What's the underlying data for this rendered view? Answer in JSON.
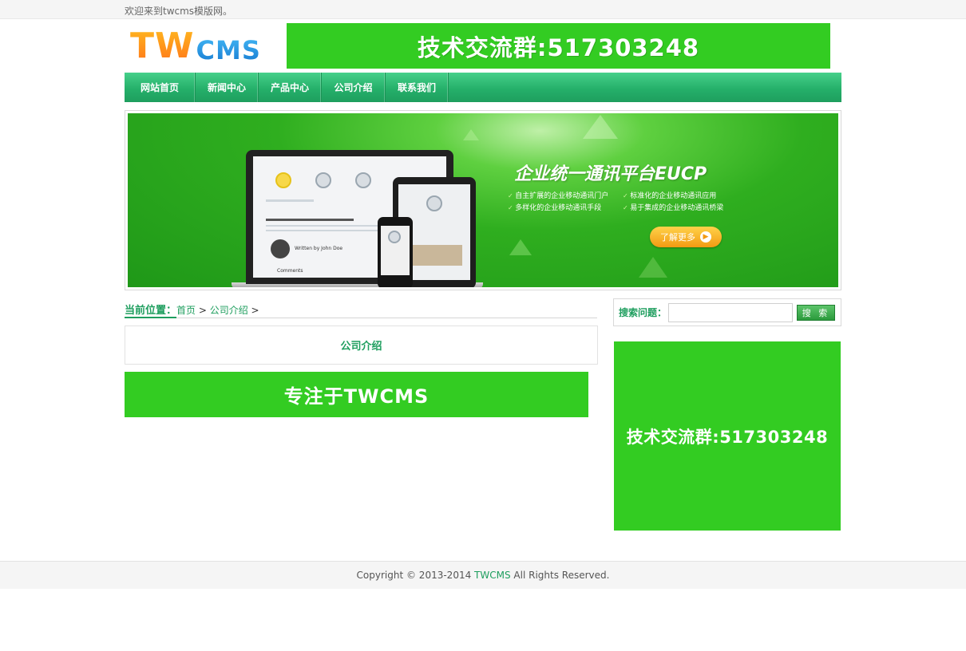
{
  "topbar": {
    "welcome": "欢迎来到twcms模版网。"
  },
  "header": {
    "logo_tw": "TW",
    "logo_cms": "CMS",
    "ad_text": "技术交流群:517303248"
  },
  "nav": {
    "items": [
      {
        "label": "网站首页"
      },
      {
        "label": "新闻中心"
      },
      {
        "label": "产品中心"
      },
      {
        "label": "公司介绍"
      },
      {
        "label": "联系我们"
      }
    ]
  },
  "banner": {
    "title": "企业统一通讯平台EUCP",
    "features": [
      "自主扩展的企业移动通讯门户",
      "标准化的企业移动通讯应用",
      "多样化的企业移动通讯手段",
      "易于集成的企业移动通讯桥梁"
    ],
    "button_label": "了解更多",
    "screen_caption": "Comments",
    "screen_author": "Written by John Doe"
  },
  "breadcrumb": {
    "label": "当前位置：",
    "home": "首页",
    "sep1": " > ",
    "current": "公司介绍",
    "sep2": " >"
  },
  "main": {
    "page_title": "公司介绍",
    "content_ad": "专注于TWCMS"
  },
  "sidebar": {
    "search_label": "搜索问题：",
    "search_value": "",
    "search_button": "搜 索",
    "ad_text": "技术交流群:517303248"
  },
  "footer": {
    "copyright_prefix": "Copyright © 2013-2014 ",
    "brand": "TWCMS",
    "copyright_suffix": " All Rights Reserved."
  },
  "colors": {
    "brand_green": "#1e9e5e",
    "ad_green": "#33cc22",
    "logo_orange": "#ff9a1e",
    "logo_blue": "#1a8fe0"
  }
}
